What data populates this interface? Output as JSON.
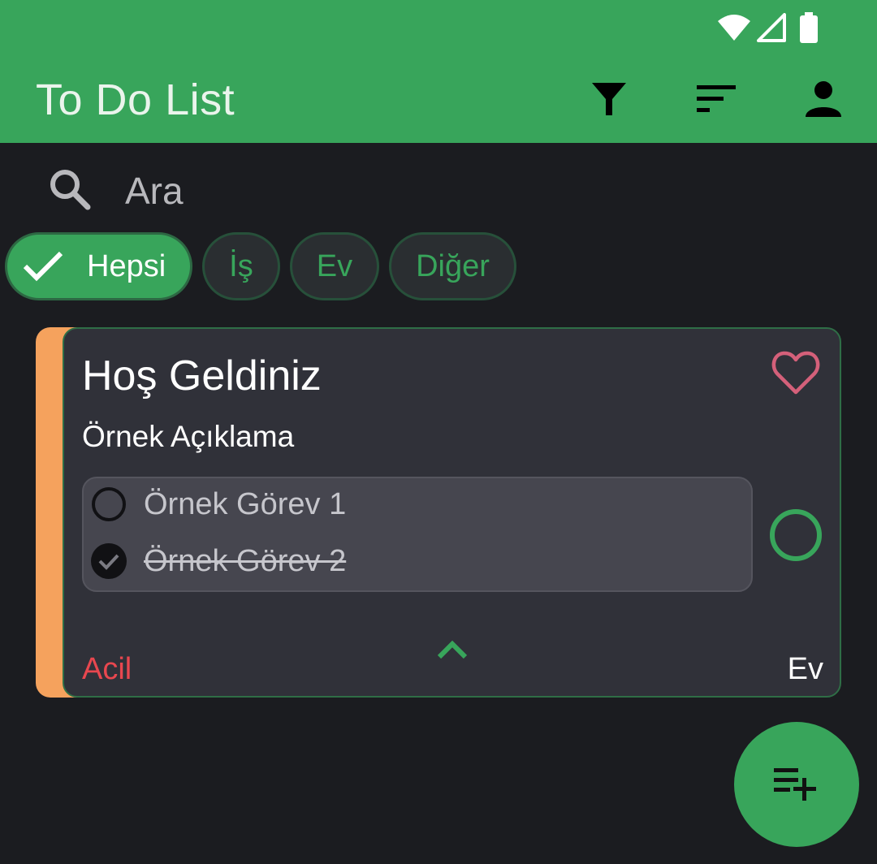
{
  "app": {
    "title": "To Do List"
  },
  "status_bar": {
    "icons": [
      "wifi-icon",
      "cellular-signal-icon",
      "battery-icon"
    ]
  },
  "toolbar": {
    "actions": [
      {
        "name": "filter-button",
        "icon": "filter-icon"
      },
      {
        "name": "sort-button",
        "icon": "sort-icon"
      },
      {
        "name": "account-button",
        "icon": "person-icon"
      }
    ]
  },
  "search": {
    "placeholder": "Ara"
  },
  "filters": {
    "chips": [
      {
        "label": "Hepsi",
        "selected": true
      },
      {
        "label": "İş",
        "selected": false
      },
      {
        "label": "Ev",
        "selected": false
      },
      {
        "label": "Diğer",
        "selected": false
      }
    ]
  },
  "task": {
    "title": "Hoş Geldiniz",
    "description": "Örnek Açıklama",
    "favorite": false,
    "completed": false,
    "subtasks": [
      {
        "label": "Örnek Görev 1",
        "done": false
      },
      {
        "label": "Örnek Görev 2",
        "done": true
      }
    ],
    "priority": "Acil",
    "category": "Ev",
    "accent_color": "#f5a25d"
  },
  "colors": {
    "primary": "#38a55b",
    "background": "#1b1c20",
    "card": "#303139",
    "priority_urgent": "#e8474f",
    "favorite": "#d4607a"
  },
  "fab": {
    "icon": "playlist-add-icon"
  }
}
